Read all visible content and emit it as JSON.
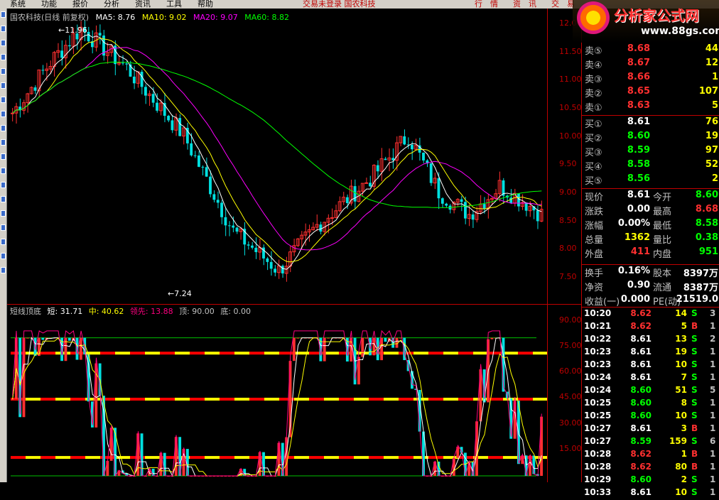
{
  "menubar": {
    "items": [
      "系统",
      "功能",
      "报价",
      "分析",
      "资讯",
      "工具",
      "帮助"
    ],
    "center": "交易未登录  国农科技",
    "right_buttons": [
      "行",
      "情",
      "资",
      "讯",
      "交",
      "易"
    ]
  },
  "logo": {
    "title": "分析家公式网",
    "url": "www.88gs.com"
  },
  "main_chart": {
    "stock": "国农科技(日线 前复权)",
    "ma": [
      {
        "label": "MA5: 8.76",
        "color": "#ffffff"
      },
      {
        "label": "MA10: 9.02",
        "color": "#ffff00"
      },
      {
        "label": "MA20: 9.07",
        "color": "#ff00ff"
      },
      {
        "label": "MA60: 8.82",
        "color": "#00ff00"
      }
    ],
    "high_label": "11.96",
    "low_label": "7.24",
    "axis_ticks": [
      "12.00",
      "11.50",
      "11.00",
      "10.50",
      "10.00",
      "9.50",
      "9.00",
      "8.50",
      "8.00",
      "7.50"
    ]
  },
  "indicator": {
    "name": "短线顶底",
    "short": "短: 31.71",
    "mid": "中: 40.62",
    "lead": "领先: 13.88",
    "top": "顶: 90.00",
    "bottom": "底: 0.00",
    "axis_ticks": [
      "90.00",
      "75.00",
      "60.00",
      "45.00",
      "30.00",
      "15.00"
    ]
  },
  "quote": {
    "asks": [
      {
        "label": "卖⑤",
        "price": "8.68",
        "vol": "44"
      },
      {
        "label": "卖④",
        "price": "8.67",
        "vol": "12"
      },
      {
        "label": "卖③",
        "price": "8.66",
        "vol": "1"
      },
      {
        "label": "卖②",
        "price": "8.65",
        "vol": "107"
      },
      {
        "label": "卖①",
        "price": "8.63",
        "vol": "5"
      }
    ],
    "bids": [
      {
        "label": "买①",
        "price": "8.61",
        "vol": "76"
      },
      {
        "label": "买②",
        "price": "8.60",
        "vol": "19"
      },
      {
        "label": "买③",
        "price": "8.59",
        "vol": "97"
      },
      {
        "label": "买④",
        "price": "8.58",
        "vol": "52"
      },
      {
        "label": "买⑤",
        "price": "8.56",
        "vol": "2"
      }
    ],
    "stats": [
      {
        "l1": "现价",
        "v1": "8.61",
        "c1": "#ffffff",
        "l2": "今开",
        "v2": "8.60",
        "c2": "#00ff00"
      },
      {
        "l1": "涨跌",
        "v1": "0.00",
        "c1": "#ffffff",
        "l2": "最高",
        "v2": "8.68",
        "c2": "#ff3030"
      },
      {
        "l1": "涨幅",
        "v1": "0.00%",
        "c1": "#ffffff",
        "l2": "最低",
        "v2": "8.58",
        "c2": "#00ff00"
      },
      {
        "l1": "总量",
        "v1": "1362",
        "c1": "#ffff00",
        "l2": "量比",
        "v2": "0.38",
        "c2": "#00ff00"
      },
      {
        "l1": "外盘",
        "v1": "411",
        "c1": "#ff3030",
        "l2": "内盘",
        "v2": "951",
        "c2": "#00ff00"
      }
    ],
    "stats2": [
      {
        "l1": "换手",
        "v1": "0.16%",
        "l2": "股本",
        "v2": "8397万"
      },
      {
        "l1": "净资",
        "v1": "0.90",
        "l2": "流通",
        "v2": "8387万"
      },
      {
        "l1": "收益(一)",
        "v1": "0.000",
        "l2": "PE(动)",
        "v2": "21519.0"
      }
    ]
  },
  "ticks": [
    {
      "t": "10:20",
      "p": "8.62",
      "pc": "#ff3030",
      "v": "14",
      "s": "S",
      "sc": "#00ff00",
      "n": "3"
    },
    {
      "t": "10:21",
      "p": "8.62",
      "pc": "#ff3030",
      "v": "5",
      "s": "B",
      "sc": "#ff3030",
      "n": "1"
    },
    {
      "t": "10:22",
      "p": "8.61",
      "pc": "#ffffff",
      "v": "13",
      "s": "S",
      "sc": "#00ff00",
      "n": "2"
    },
    {
      "t": "10:23",
      "p": "8.61",
      "pc": "#ffffff",
      "v": "19",
      "s": "S",
      "sc": "#00ff00",
      "n": "1"
    },
    {
      "t": "10:23",
      "p": "8.61",
      "pc": "#ffffff",
      "v": "10",
      "s": "S",
      "sc": "#00ff00",
      "n": "1"
    },
    {
      "t": "10:24",
      "p": "8.61",
      "pc": "#ffffff",
      "v": "7",
      "s": "S",
      "sc": "#00ff00",
      "n": "1"
    },
    {
      "t": "10:24",
      "p": "8.60",
      "pc": "#00ff00",
      "v": "51",
      "s": "S",
      "sc": "#00ff00",
      "n": "5"
    },
    {
      "t": "10:25",
      "p": "8.60",
      "pc": "#00ff00",
      "v": "8",
      "s": "S",
      "sc": "#00ff00",
      "n": "1"
    },
    {
      "t": "10:25",
      "p": "8.60",
      "pc": "#00ff00",
      "v": "10",
      "s": "S",
      "sc": "#00ff00",
      "n": "1"
    },
    {
      "t": "10:27",
      "p": "8.61",
      "pc": "#ffffff",
      "v": "3",
      "s": "B",
      "sc": "#ff3030",
      "n": "1"
    },
    {
      "t": "10:27",
      "p": "8.59",
      "pc": "#00ff00",
      "v": "159",
      "s": "S",
      "sc": "#00ff00",
      "n": "6"
    },
    {
      "t": "10:28",
      "p": "8.62",
      "pc": "#ff3030",
      "v": "1",
      "s": "B",
      "sc": "#ff3030",
      "n": "1"
    },
    {
      "t": "10:28",
      "p": "8.62",
      "pc": "#ff3030",
      "v": "80",
      "s": "B",
      "sc": "#ff3030",
      "n": "1"
    },
    {
      "t": "10:29",
      "p": "8.60",
      "pc": "#00ff00",
      "v": "2",
      "s": "S",
      "sc": "#00ff00",
      "n": "1"
    },
    {
      "t": "10:33",
      "p": "8.61",
      "pc": "#ffffff",
      "v": "10",
      "s": "S",
      "sc": "#00ff00",
      "n": "1"
    }
  ],
  "colors": {
    "up": "#ff3030",
    "down": "#00e0e0",
    "ma5": "#ffffff",
    "ma10": "#ffff00",
    "ma20": "#ff00ff",
    "ma60": "#00ff00",
    "lead": "#ff0080",
    "band_red": "#ff0000",
    "band_yellow": "#ffff00"
  }
}
